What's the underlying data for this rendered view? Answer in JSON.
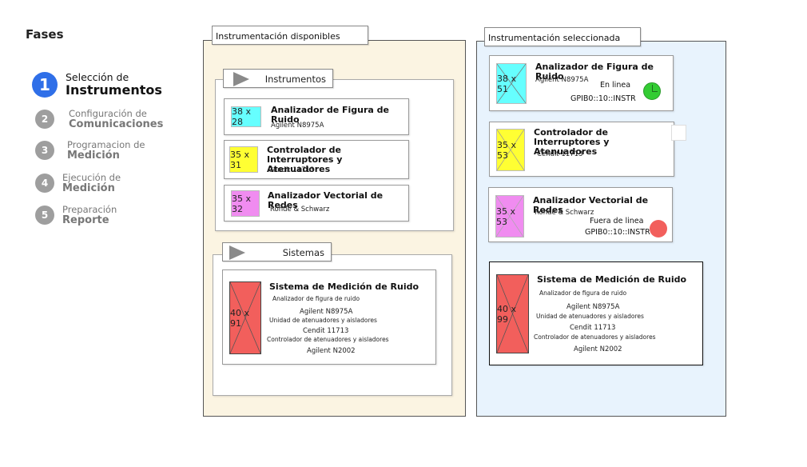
{
  "sidebar": {
    "title": "Fases",
    "steps": [
      {
        "num": "1",
        "line1": "Selección de",
        "line2": "Instrumentos"
      },
      {
        "num": "2",
        "line1": "Configuración de",
        "line2": "Comunicaciones"
      },
      {
        "num": "3",
        "line1": "Programacion de",
        "line2": "Medición"
      },
      {
        "num": "4",
        "line1": "Ejecución de",
        "line2": "Medición"
      },
      {
        "num": "5",
        "line1": "Preparación",
        "line2": "Reporte"
      }
    ]
  },
  "available": {
    "title": "Instrumentación disponibles",
    "instruments_header": "Instrumentos",
    "instruments": [
      {
        "name": "Analizador de Figura de Ruido",
        "model": "Agilent N8975A",
        "thumb": "38 x 28",
        "color": "#66ffff"
      },
      {
        "name": "Controlador de Interruptores y Atenuadores",
        "model": "Cendit 11713",
        "thumb": "35 x 31",
        "color": "#ffff33"
      },
      {
        "name": "Analizador Vectorial de Redes",
        "model": "Rohde & Schwarz",
        "thumb": "35 x 32",
        "color": "#f08cf0"
      }
    ],
    "systems_header": "Sistemas",
    "system": {
      "name": "Sistema de Medición de Ruido",
      "thumb": "40 x 91",
      "color": "#f25f5c",
      "lines": [
        {
          "text": "Analizador de figura de ruido",
          "size": "tiny"
        },
        {
          "text": "Agilent N8975A",
          "size": "sub"
        },
        {
          "text": "Unidad de atenuadores y aisladores",
          "size": "tiny"
        },
        {
          "text": "Cendit 11713",
          "size": "sub"
        },
        {
          "text": "Controlador de atenuadores y aisladores",
          "size": "tiny"
        },
        {
          "text": "Agilent N2002",
          "size": "sub"
        }
      ]
    }
  },
  "selected": {
    "title": "Instrumentación seleccionada",
    "instruments": [
      {
        "name": "Analizador de Figura de Ruido",
        "model": "Agilent N8975A",
        "thumb": "38 x 51",
        "color": "#66ffff",
        "status": "En linea",
        "address": "GPIB0::10::INSTR",
        "status_color": "#33cc33"
      },
      {
        "name": "Controlador de Interruptores y Atenuadores",
        "model": "Cendit 11713",
        "thumb": "35 x 53",
        "color": "#ffff33"
      },
      {
        "name": "Analizador Vectorial de Redes",
        "model": "Rohde & Schwarz",
        "thumb": "35 x 53",
        "color": "#f08cf0",
        "status": "Fuera de linea",
        "address": "GPIB0::10::INSTR",
        "status_color": "#f25f5c"
      }
    ],
    "system": {
      "name": "Sistema de Medición de Ruido",
      "thumb": "40 x 99",
      "color": "#f25f5c",
      "lines": [
        {
          "text": "Analizador de figura de ruido",
          "size": "tiny"
        },
        {
          "text": "Agilent N8975A",
          "size": "sub"
        },
        {
          "text": "Unidad de atenuadores y aisladores",
          "size": "tiny"
        },
        {
          "text": "Cendit 11713",
          "size": "sub"
        },
        {
          "text": "Controlador de atenuadores y aisladores",
          "size": "tiny"
        },
        {
          "text": "Agilent N2002",
          "size": "sub"
        }
      ]
    }
  },
  "colors": {
    "available_bg": "#fbf4e2",
    "selected_bg": "#e8f3fd",
    "active_step": "#2f6fe8"
  }
}
